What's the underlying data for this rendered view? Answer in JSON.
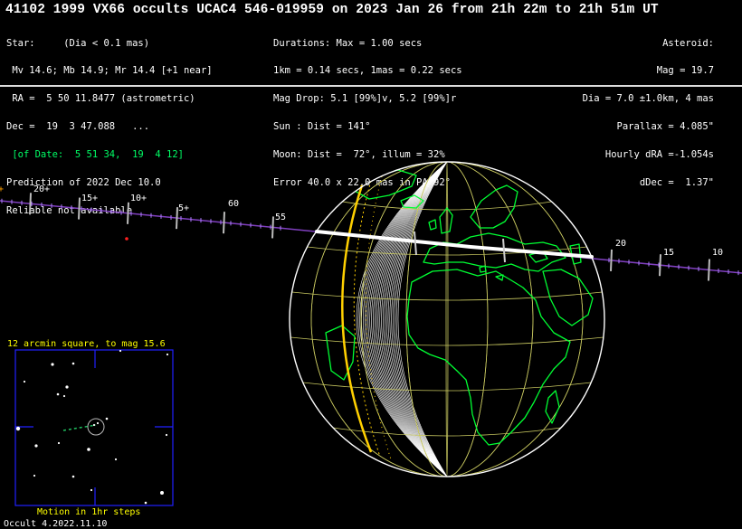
{
  "title": "41102 1999 VX66 occults UCAC4 546-019959 on 2023 Jan 26 from 21h 22m to 21h 51m UT",
  "star": {
    "heading": "Star:",
    "dia": "(Dia < 0.1 mas)",
    "mags": "Mv 14.6; Mb 14.9; Mr 14.4 [+1 near]",
    "ra": "RA =  5 50 11.8477 (astrometric)",
    "dec": "Dec =  19  3 47.088   ...",
    "of_date": "[of Date:  5 51 34,  19  4 12]",
    "prediction": "Prediction of 2022 Dec 10.0",
    "reliable": "Reliable not available"
  },
  "event": {
    "durations": "Durations: Max = 1.00 secs",
    "scale": "1km = 0.14 secs, 1mas = 0.22 secs",
    "mag_drop": "Mag Drop: 5.1 [99%]v, 5.2 [99%]r",
    "sun": "Sun : Dist = 141°",
    "moon": "Moon: Dist =  72°, illum = 32%",
    "error": "Error 40.0 x 22.0 mas in PA 92°"
  },
  "asteroid": {
    "heading": "Asteroid:",
    "mag": "Mag = 19.7",
    "dia": "Dia = 7.0 ±1.0km, 4 mas",
    "parallax": "Parallax = 4.085\"",
    "hourly_dra": "Hourly dRA =-1.054s",
    "ddec": "dDec =  1.37\""
  },
  "track": {
    "left_labels": [
      "20+",
      "15+",
      "10+",
      "5+",
      "60",
      "55"
    ],
    "right_labels": [
      "20",
      "15",
      "10"
    ]
  },
  "inset": {
    "title": "12 arcmin square, to mag 15.6",
    "caption": "Motion in 1hr steps"
  },
  "footer": "Occult 4.2022.11.10",
  "colors": {
    "background": "#000000",
    "coastline": "#00ff33",
    "grid": "#c8c860",
    "terminator": "#ffd000",
    "path": "#ffffff",
    "track": "#8040c0",
    "inset_frame": "#2020ff",
    "inset_text": "#ffff00"
  }
}
